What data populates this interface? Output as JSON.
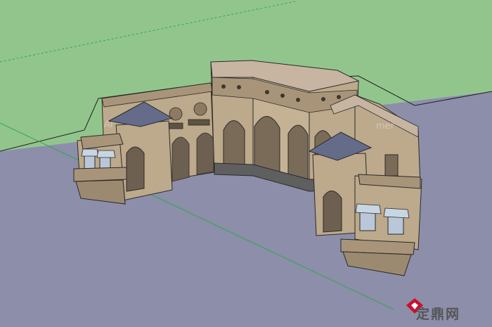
{
  "viewport": {
    "scene": "sketchup-model-view",
    "colors": {
      "sky": "#92C58C",
      "ground": "#8C8EAA",
      "wall": "#BDA98B",
      "wall_dark": "#8E7A62",
      "roof": "#C7B5A2",
      "pavilion_roof": "#646C8A",
      "plinth": "#5E5F5E",
      "window_glass": "#B9C7D8",
      "awning": "#C8D6E2",
      "axis_green": "#2FA84A"
    }
  },
  "watermark": {
    "brand_text": "定鼎网",
    "ghost_text_right": "mer",
    "ghost_text_left": "Ar"
  }
}
